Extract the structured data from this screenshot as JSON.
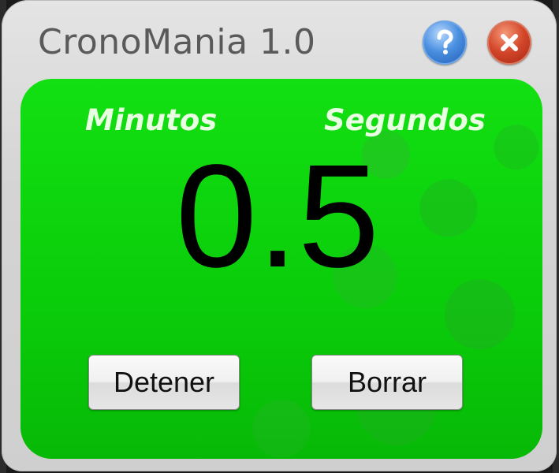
{
  "window": {
    "title": "CronoMania 1.0",
    "help_icon": "question-mark-icon",
    "close_icon": "close-x-icon"
  },
  "timer": {
    "minutes_label": "Minutos",
    "seconds_label": "Segundos",
    "display": "0.5"
  },
  "buttons": {
    "stop_label": "Detener",
    "clear_label": "Borrar"
  },
  "colors": {
    "panel_green": "#0acc0a",
    "label_text": "#e9ffe2",
    "help_blue": "#4a8fe0",
    "close_red": "#d4482b"
  }
}
